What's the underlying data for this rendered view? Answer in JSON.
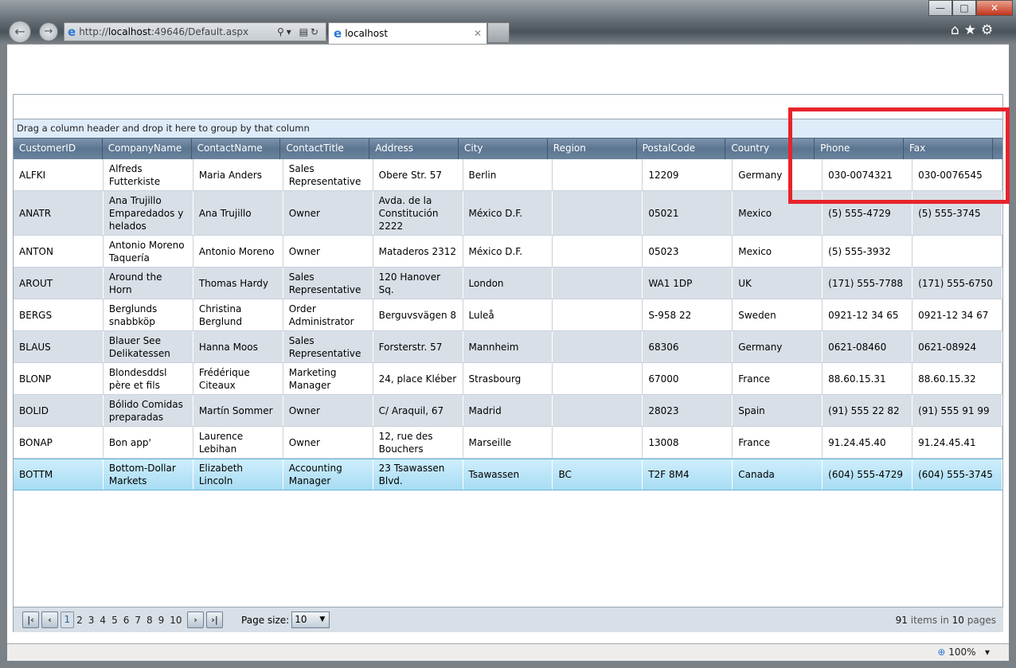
{
  "browser": {
    "url_prefix": "http://",
    "url_host": "localhost",
    "url_rest": ":49646/Default.aspx",
    "tab_title": "localhost",
    "zoom": "100%"
  },
  "grid": {
    "group_hint": "Drag a column header and drop it here to group by that column",
    "columns": [
      "CustomerID",
      "CompanyName",
      "ContactName",
      "ContactTitle",
      "Address",
      "City",
      "Region",
      "PostalCode",
      "Country",
      "Phone",
      "Fax"
    ],
    "rows": [
      [
        "ALFKI",
        "Alfreds Futterkiste",
        "Maria Anders",
        "Sales Representative",
        "Obere Str. 57",
        "Berlin",
        "",
        "12209",
        "Germany",
        "030-0074321",
        "030-0076545"
      ],
      [
        "ANATR",
        "Ana Trujillo Emparedados y helados",
        "Ana Trujillo",
        "Owner",
        "Avda. de la Constitución 2222",
        "México D.F.",
        "",
        "05021",
        "Mexico",
        "(5) 555-4729",
        "(5) 555-3745"
      ],
      [
        "ANTON",
        "Antonio Moreno Taquería",
        "Antonio Moreno",
        "Owner",
        "Mataderos 2312",
        "México D.F.",
        "",
        "05023",
        "Mexico",
        "(5) 555-3932",
        ""
      ],
      [
        "AROUT",
        "Around the Horn",
        "Thomas Hardy",
        "Sales Representative",
        "120 Hanover Sq.",
        "London",
        "",
        "WA1 1DP",
        "UK",
        "(171) 555-7788",
        "(171) 555-6750"
      ],
      [
        "BERGS",
        "Berglunds snabbköp",
        "Christina Berglund",
        "Order Administrator",
        "Berguvsvägen 8",
        "Luleå",
        "",
        "S-958 22",
        "Sweden",
        "0921-12 34 65",
        "0921-12 34 67"
      ],
      [
        "BLAUS",
        "Blauer See Delikatessen",
        "Hanna Moos",
        "Sales Representative",
        "Forsterstr. 57",
        "Mannheim",
        "",
        "68306",
        "Germany",
        "0621-08460",
        "0621-08924"
      ],
      [
        "BLONP",
        "Blondesddsl père et fils",
        "Frédérique Citeaux",
        "Marketing Manager",
        "24, place Kléber",
        "Strasbourg",
        "",
        "67000",
        "France",
        "88.60.15.31",
        "88.60.15.32"
      ],
      [
        "BOLID",
        "Bólido Comidas preparadas",
        "Martín Sommer",
        "Owner",
        "C/ Araquil, 67",
        "Madrid",
        "",
        "28023",
        "Spain",
        "(91) 555 22 82",
        "(91) 555 91 99"
      ],
      [
        "BONAP",
        "Bon app'",
        "Laurence Lebihan",
        "Owner",
        "12, rue des Bouchers",
        "Marseille",
        "",
        "13008",
        "France",
        "91.24.45.40",
        "91.24.45.41"
      ],
      [
        "BOTTM",
        "Bottom-Dollar Markets",
        "Elizabeth Lincoln",
        "Accounting Manager",
        "23 Tsawassen Blvd.",
        "Tsawassen",
        "BC",
        "T2F 8M4",
        "Canada",
        "(604) 555-4729",
        "(604) 555-3745"
      ]
    ],
    "selected_row": 9
  },
  "pager": {
    "pages": [
      "1",
      "2",
      "3",
      "4",
      "5",
      "6",
      "7",
      "8",
      "9",
      "10"
    ],
    "current": "1",
    "page_size_label": "Page size:",
    "page_size": "10",
    "items_count": "91",
    "items_text": " items in ",
    "pages_count": "10",
    "pages_text": " pages"
  }
}
